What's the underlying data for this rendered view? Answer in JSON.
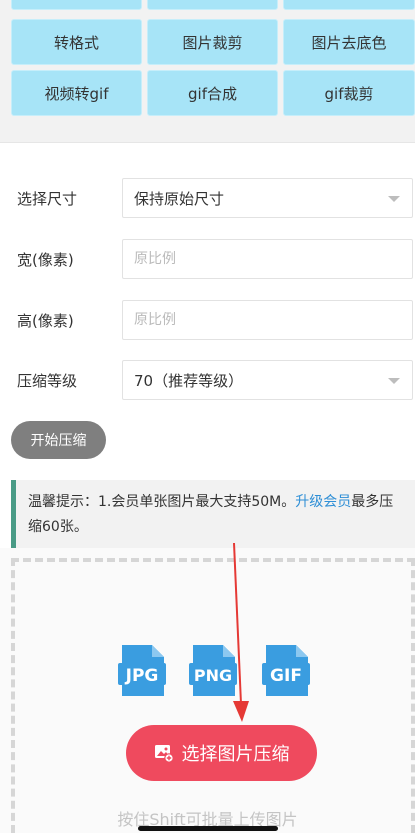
{
  "tools": {
    "row1": [
      "转格式",
      "图片裁剪",
      "图片去底色"
    ],
    "row2": [
      "视频转gif",
      "gif合成",
      "gif裁剪"
    ]
  },
  "form": {
    "size_label": "选择尺寸",
    "size_value": "保持原始尺寸",
    "width_label": "宽(像素)",
    "width_placeholder": "原比例",
    "height_label": "高(像素)",
    "height_placeholder": "原比例",
    "level_label": "压缩等级",
    "level_value": "70（推荐等级）",
    "start_label": "开始压缩"
  },
  "notice": {
    "prefix": "温馨提示：1.会员单张图片最大支持50M。",
    "link": "升级会员",
    "suffix": "最多压缩60张。"
  },
  "upload": {
    "formats": [
      "JPG",
      "PNG",
      "GIF"
    ],
    "button_label": "选择图片压缩",
    "hint": "按住Shift可批量上传图片"
  },
  "colors": {
    "tool_bg": "#a7e4f7",
    "pick_button": "#ef4a5e",
    "file_icon": "#3a9de0",
    "notice_bar": "#4a9b86",
    "link": "#2f8fd6",
    "annotation_arrow": "#e53935"
  }
}
